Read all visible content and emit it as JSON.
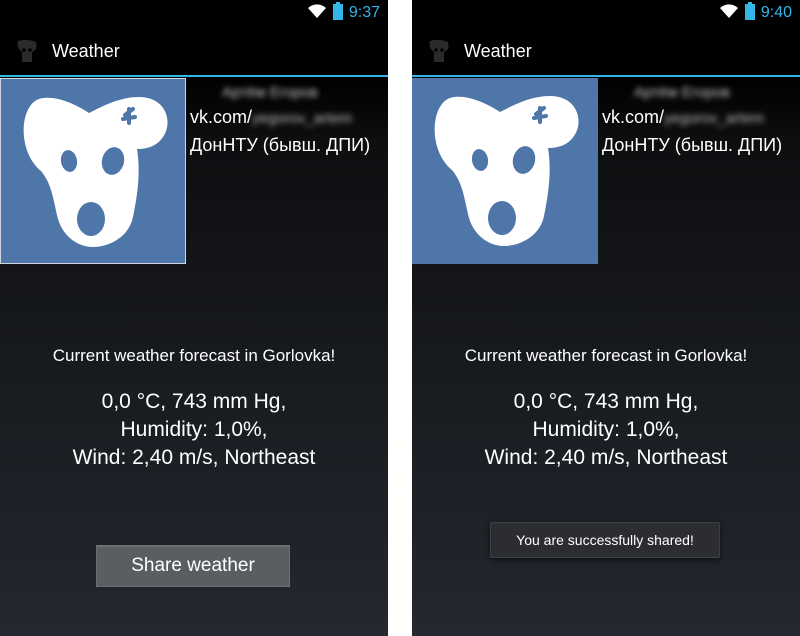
{
  "screens": [
    {
      "status": {
        "time": "9:37"
      },
      "actionbar": {
        "title": "Weather"
      },
      "profile": {
        "name": "Артём Егоров",
        "vk_prefix": "vk.com/",
        "vk_handle": "yegorov_artem",
        "university": "ДонНТУ (бывш. ДПИ)"
      },
      "forecast": {
        "title": "Current weather forecast in Gorlovka!",
        "line1": "0,0 °C, 743 mm Hg,",
        "line2": "Humidity: 1,0%,",
        "line3": "Wind: 2,40 m/s, Northeast"
      },
      "share_button": "Share weather"
    },
    {
      "status": {
        "time": "9:40"
      },
      "actionbar": {
        "title": "Weather"
      },
      "profile": {
        "name": "Артём Егоров",
        "vk_prefix": "vk.com/",
        "vk_handle": "yegorov_artem",
        "university": "ДонНТУ (бывш. ДПИ)"
      },
      "forecast": {
        "title": "Current weather forecast in Gorlovka!",
        "line1": "0,0 °C, 743 mm Hg,",
        "line2": "Humidity: 1,0%,",
        "line3": "Wind: 2,40 m/s, Northeast"
      },
      "toast": "You are successfully shared!"
    }
  ],
  "icons": {
    "wifi": "wifi-icon",
    "battery": "battery-icon",
    "app": "vk-dog-app-icon",
    "avatar": "vk-dog-logo"
  },
  "colors": {
    "holo_blue": "#33b5e5",
    "avatar_bg": "#4f76a8",
    "button_bg": "#5a5d62",
    "toast_bg": "#2b2d30"
  }
}
